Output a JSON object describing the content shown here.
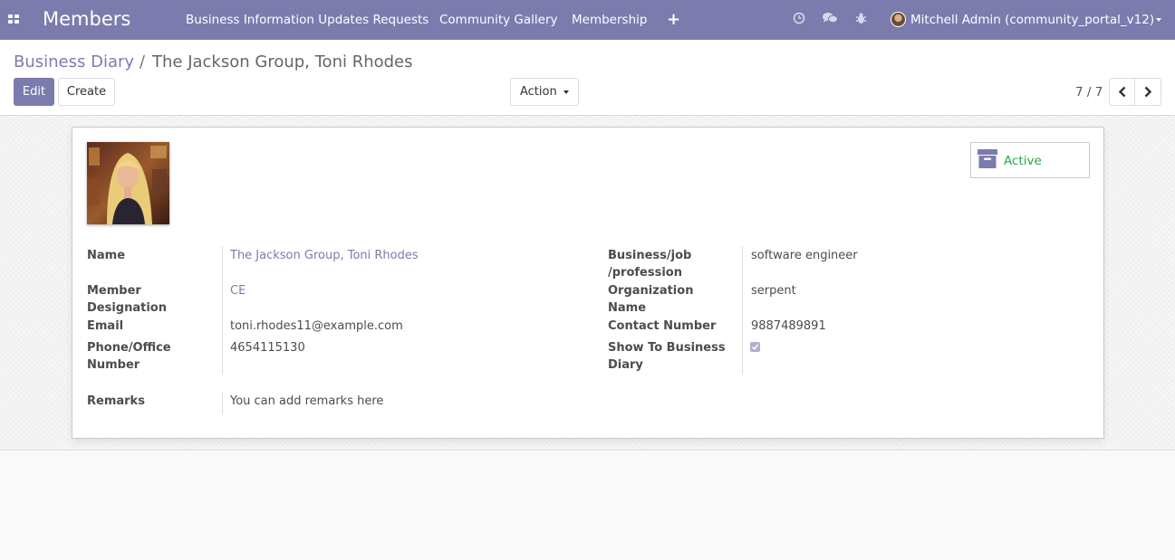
{
  "navbar": {
    "app_title": "Members",
    "menu": [
      "Business Information Updates Requests",
      "Community Gallery",
      "Membership"
    ],
    "add_label": "+",
    "user_name": "Mitchell Admin (community_portal_v12)"
  },
  "breadcrumb": {
    "parent": "Business Diary",
    "separator": "/",
    "current": "The Jackson Group, Toni Rhodes"
  },
  "buttons": {
    "edit": "Edit",
    "create": "Create",
    "action": "Action"
  },
  "pager": {
    "value": "7 / 7"
  },
  "status": {
    "label": "Active"
  },
  "form": {
    "name_label": "Name",
    "name_value": "The Jackson Group, Toni Rhodes",
    "designation_label": "Member Designation",
    "designation_value": "CE",
    "email_label": "Email",
    "email_value": "toni.rhodes11@example.com",
    "phone_label": "Phone/Office Number",
    "phone_value": "4654115130",
    "profession_label": "Business/job /profession",
    "profession_value": "software engineer",
    "org_label": "Organization Name",
    "org_value": "serpent",
    "contact_label": "Contact Number",
    "contact_value": "9887489891",
    "show_label": "Show To Business Diary",
    "show_value": true,
    "remarks_label": "Remarks",
    "remarks_value": "You can add remarks here"
  },
  "colors": {
    "brand": "#7c7bad",
    "active": "#28a745"
  }
}
